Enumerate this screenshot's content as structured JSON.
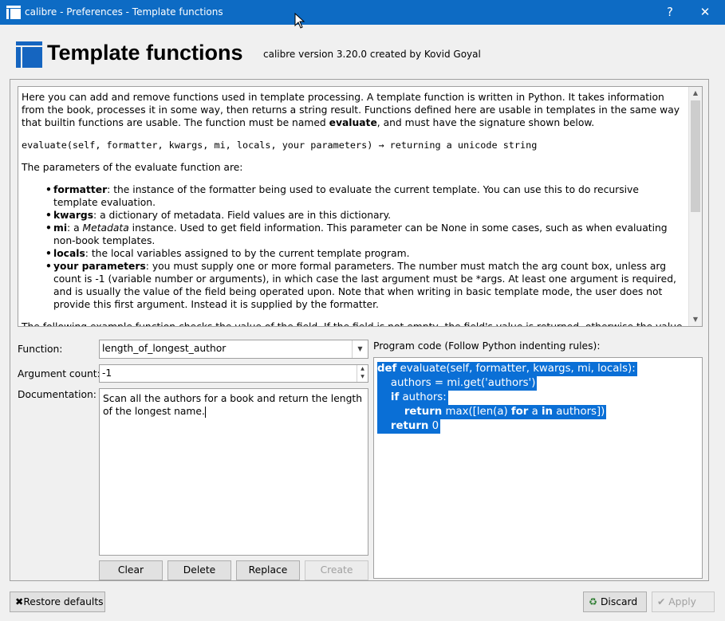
{
  "window": {
    "title": "calibre - Preferences - Template functions",
    "help_button": "?",
    "close_button": "✕"
  },
  "header": {
    "title": "Template functions",
    "version": "calibre version 3.20.0 created by Kovid Goyal"
  },
  "help": {
    "intro_1": "Here you can add and remove functions used in template processing. A template function is written in Python. It takes information from the book, processes it in some way, then returns a string result. Functions defined here are usable in templates in the same way that builtin functions are usable. The function must be named ",
    "intro_bold": "evaluate",
    "intro_2": ", and must have the signature shown below.",
    "signature": "evaluate(self, formatter, kwargs, mi, locals, your parameters) → returning a unicode string",
    "params_heading": "The parameters of the evaluate function are:",
    "params": [
      {
        "name": "formatter",
        "text": ": the instance of the formatter being used to evaluate the current template. You can use this to do recursive template evaluation."
      },
      {
        "name": "kwargs",
        "text": ": a dictionary of metadata. Field values are in this dictionary."
      },
      {
        "name": "mi",
        "text_a": ": a ",
        "italic": "Metadata",
        "text_b": " instance. Used to get field information. This parameter can be None in some cases, such as when evaluating non-book templates."
      },
      {
        "name": "locals",
        "text": ": the local variables assigned to by the current template program."
      },
      {
        "name": "your parameters",
        "text": ": you must supply one or more formal parameters. The number must match the arg count box, unless arg count is -1 (variable number or arguments), in which case the last argument must be *args. At least one argument is required, and is usually the value of the field being operated upon. Note that when writing in basic template mode, the user does not provide this first argument. Instead it is supplied by the formatter."
      }
    ],
    "truncated": "The following example function checks the value of the field. If the field is not empty, the field's value is returned, otherwise the value EMPTY is"
  },
  "form": {
    "function_label": "Function:",
    "function_value": "length_of_longest_author",
    "argcount_label": "Argument count:",
    "argcount_value": "-1",
    "documentation_label": "Documentation:",
    "documentation_value": "Scan all the authors for a book and return the length of the longest name.",
    "program_label": "Program code (Follow Python indenting rules):"
  },
  "code": {
    "l1_kw": "def",
    "l1_rest": " evaluate(self, formatter, kwargs, mi, locals):",
    "l2": "    authors = mi.get('authors')",
    "l3_kw": "if",
    "l3_rest": " authors:",
    "l4_kw1": "return",
    "l4_mid": " max([len(a) ",
    "l4_kw2": "for",
    "l4_mid2": " a ",
    "l4_kw3": "in",
    "l4_end": " authors])",
    "l5_kw": "return",
    "l5_rest": " 0"
  },
  "buttons": {
    "clear": "Clear",
    "delete": "Delete",
    "replace": "Replace",
    "create": "Create",
    "restore": "Restore defaults",
    "discard": "Discard",
    "apply": "Apply"
  }
}
